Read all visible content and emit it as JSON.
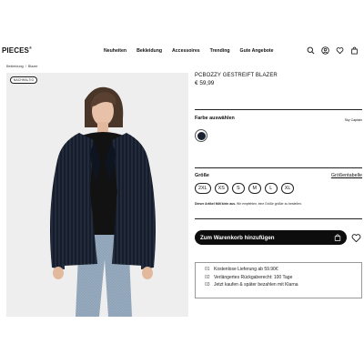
{
  "header": {
    "logo": "PIECES",
    "logo_mark": "®",
    "nav": [
      "Neuheiten",
      "Bekleidung",
      "Accessoires",
      "Trending",
      "Gute Angebote"
    ],
    "icons": [
      "search-icon",
      "account-icon",
      "wishlist-icon",
      "bag-icon"
    ]
  },
  "breadcrumb": [
    "Bekleidung",
    "/",
    "Blazer"
  ],
  "product": {
    "badge": "NACHHALTIG",
    "title": "PCBOZZY GESTREIFT BLAZER",
    "price": "€ 59,99"
  },
  "color": {
    "label": "Farbe auswählen",
    "selected": "Sky Captain",
    "swatch_hex": "#1b2232"
  },
  "size": {
    "label": "Größe",
    "guide": "Größentabelle",
    "options": [
      "2XL",
      "XS",
      "S",
      "M",
      "L",
      "XL"
    ],
    "note_bold": "Dieser Artikel fällt klein aus.",
    "note_rest": " Wir empfehlen, eine Größe größer zu bestellen."
  },
  "cart": {
    "label": "Zum Warenkorb hinzufügen"
  },
  "benefits": [
    {
      "num": "01",
      "text": "Kostenlose Lieferung ab 59.90€"
    },
    {
      "num": "02",
      "text": "Verlängertes Rückgaberecht: 100 Tage"
    },
    {
      "num": "03",
      "text": "Jetzt kaufen & später bezahlen mit Klarna"
    }
  ]
}
